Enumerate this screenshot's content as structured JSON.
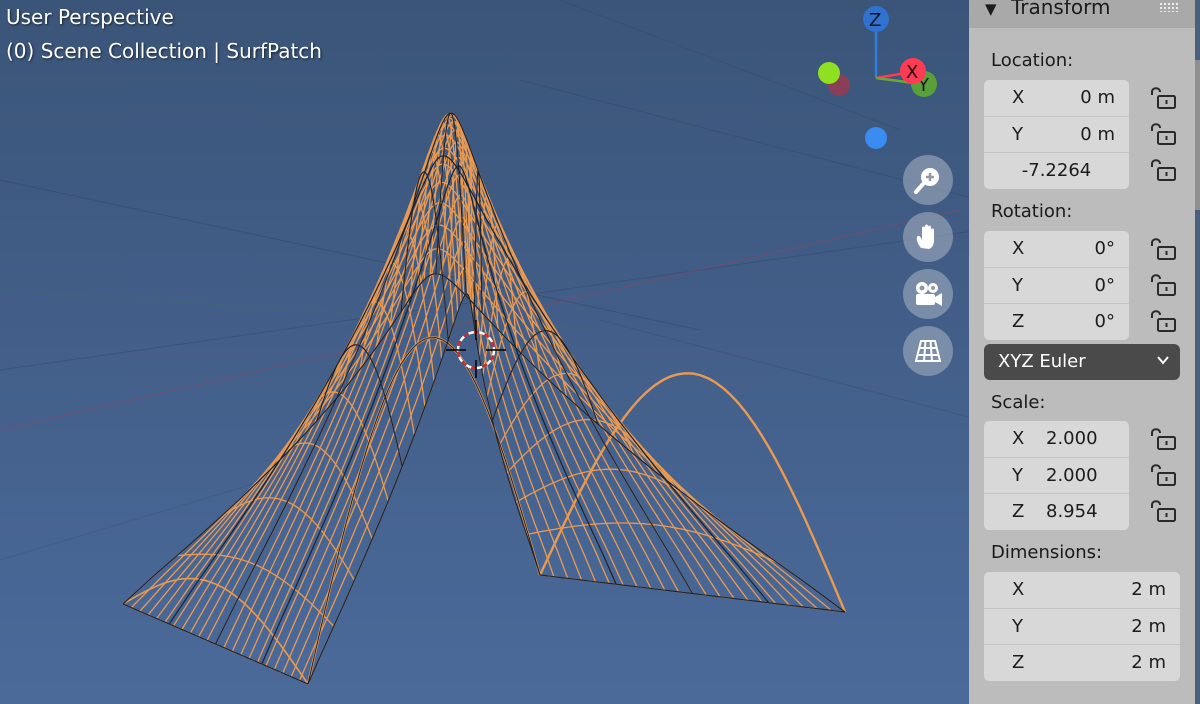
{
  "viewport": {
    "mode_label": "User Perspective",
    "object_label": "(0) Scene Collection | SurfPatch"
  },
  "gizmo": {
    "z_label": "Z",
    "x_label": "X",
    "y_label": "Y"
  },
  "nav_buttons": [
    {
      "icon": "zoom-in-icon"
    },
    {
      "icon": "hand-pan-icon"
    },
    {
      "icon": "camera-icon"
    },
    {
      "icon": "grid-ortho-icon"
    }
  ],
  "panel": {
    "title": "Transform",
    "location": {
      "label": "Location:",
      "x_axis": "X",
      "x": "0 m",
      "y_axis": "Y",
      "y": "0 m",
      "z": "-7.2264"
    },
    "rotation": {
      "label": "Rotation:",
      "x_axis": "X",
      "x": "0°",
      "y_axis": "Y",
      "y": "0°",
      "z_axis": "Z",
      "z": "0°",
      "mode": "XYZ Euler"
    },
    "scale": {
      "label": "Scale:",
      "x_axis": "X",
      "x": "2.000",
      "y_axis": "Y",
      "y": "2.000",
      "z_axis": "Z",
      "z": "8.954"
    },
    "dimensions": {
      "label": "Dimensions:",
      "x_axis": "X",
      "x": "2 m",
      "y_axis": "Y",
      "y": "2 m",
      "z_axis": "Z",
      "z": "2 m"
    }
  },
  "colors": {
    "wire_selected": "#f0a050",
    "wire_dark": "#1b2330",
    "axis_x": "#ff3a54",
    "axis_y": "#6aa83a",
    "axis_z": "#2f7fe0"
  }
}
